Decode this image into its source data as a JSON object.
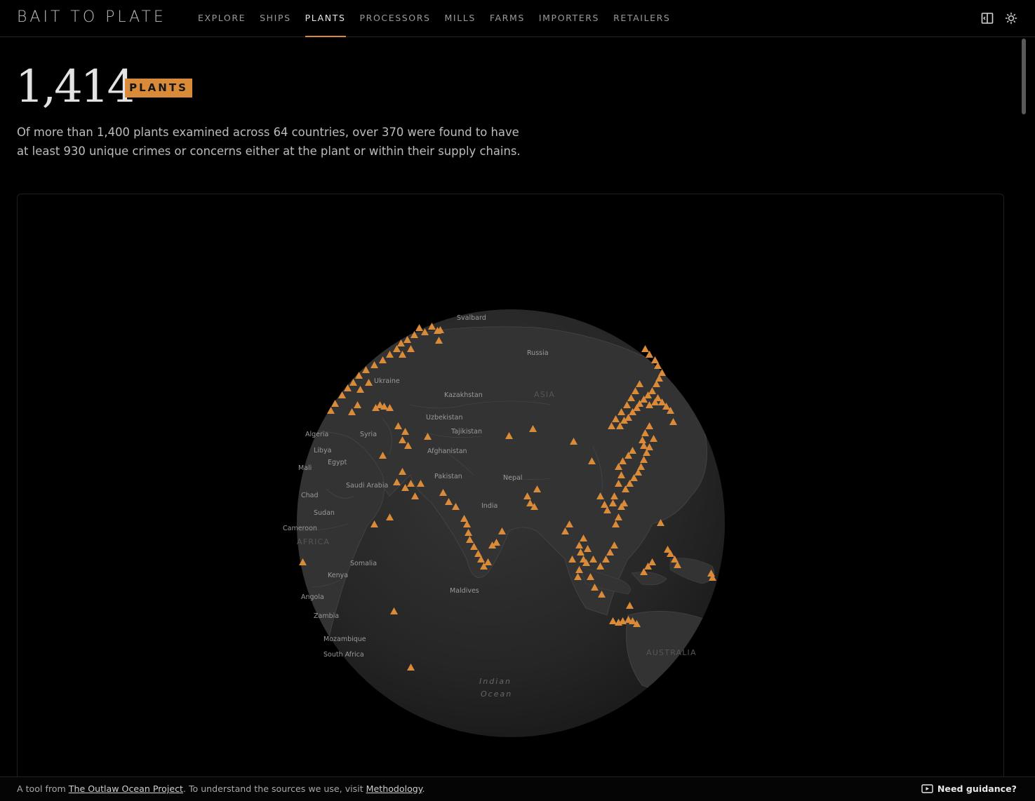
{
  "header": {
    "brand": "BAIT TO PLATE",
    "nav": [
      {
        "label": "EXPLORE",
        "active": false
      },
      {
        "label": "SHIPS",
        "active": false
      },
      {
        "label": "PLANTS",
        "active": true
      },
      {
        "label": "PROCESSORS",
        "active": false
      },
      {
        "label": "MILLS",
        "active": false
      },
      {
        "label": "FARMS",
        "active": false
      },
      {
        "label": "IMPORTERS",
        "active": false
      },
      {
        "label": "RETAILERS",
        "active": false
      }
    ],
    "icons": [
      "panel-toggle-icon",
      "sun-icon"
    ]
  },
  "hero": {
    "count": "1,414",
    "badge": "PLANTS",
    "description": "Of more than 1,400 plants examined across 64 countries, over 370 were found to have at least 930 unique crimes or concerns either at the plant or within their supply chains."
  },
  "map": {
    "labels": {
      "svalbard": "Svalbard",
      "russia": "Russia",
      "ukraine": "Ukraine",
      "kazakhstan": "Kazakhstan",
      "asia": "ASIA",
      "uzbekistan": "Uzbekistan",
      "tajikistan": "Tajikistan",
      "algeria": "Algeria",
      "syria": "Syria",
      "libya": "Libya",
      "egypt": "Egypt",
      "afghanistan": "Afghanistan",
      "mali": "Mali",
      "pakistan": "Pakistan",
      "nepal": "Nepal",
      "saudi_arabia": "Saudi Arabia",
      "chad": "Chad",
      "india": "India",
      "sudan": "Sudan",
      "cameroon": "Cameroon",
      "africa": "AFRICA",
      "somalia": "Somalia",
      "kenya": "Kenya",
      "maldives": "Maldives",
      "angola": "Angola",
      "zambia": "Zambia",
      "mozambique": "Mozambique",
      "south_africa": "South Africa",
      "australia": "AUSTRALIA",
      "indian": "Indian",
      "ocean": "Ocean"
    },
    "colors": {
      "marker": "#d98b3a",
      "globe": "#2a2a2a",
      "land": "#3a3a3a"
    }
  },
  "footer": {
    "prefix": "A tool from ",
    "link1": "The Outlaw Ocean Project",
    "middle": ". To understand the sources we use, visit ",
    "link2": "Methodology",
    "suffix": ".",
    "guidance": "Need guidance?"
  }
}
